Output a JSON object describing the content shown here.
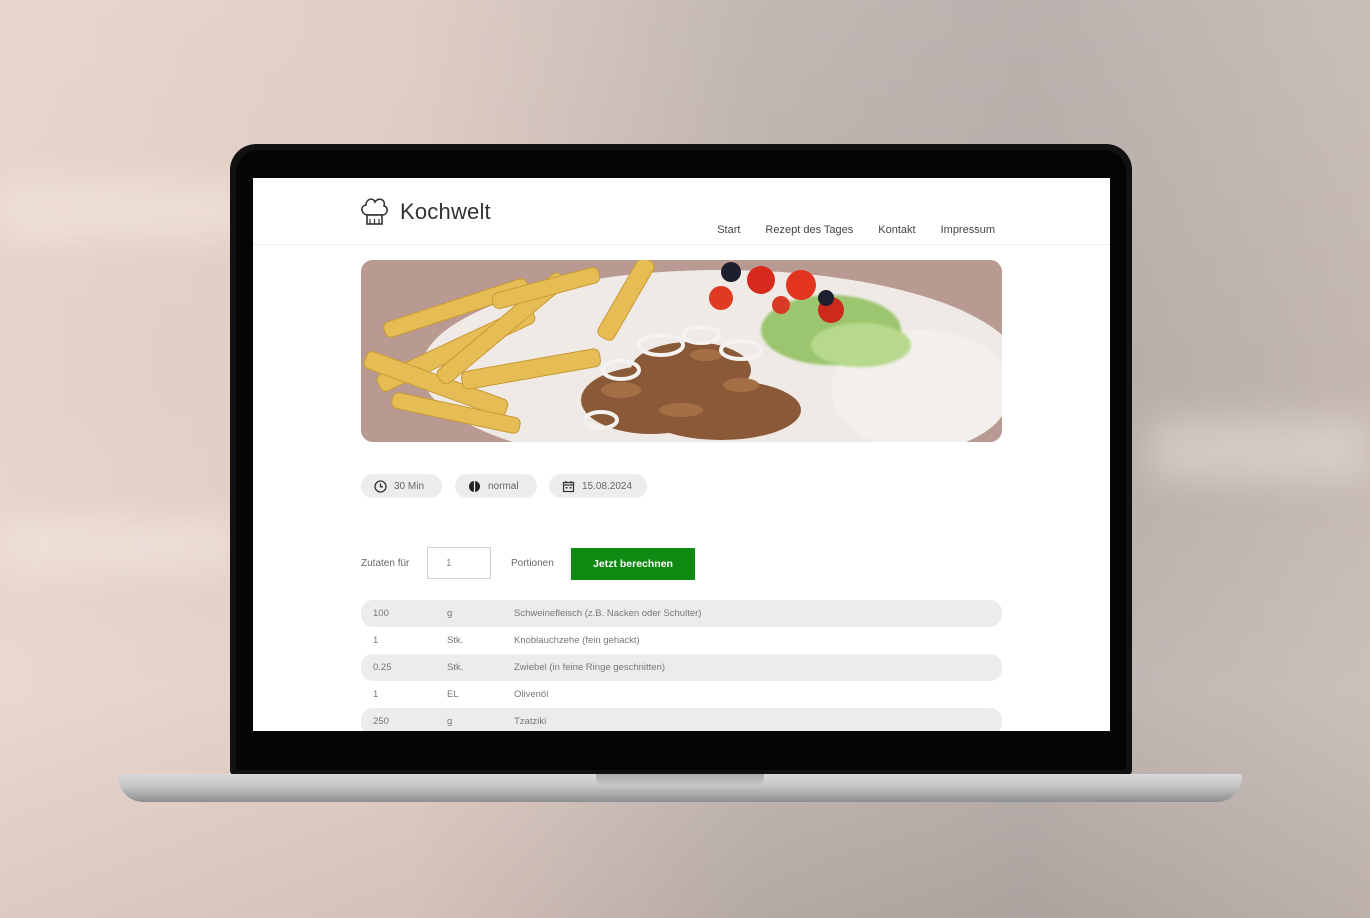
{
  "brand": "Kochwelt",
  "nav": [
    "Start",
    "Rezept des Tages",
    "Kontakt",
    "Impressum"
  ],
  "meta": {
    "time": "30 Min",
    "difficulty": "normal",
    "date": "15.08.2024"
  },
  "portions": {
    "label_before": "Zutaten für",
    "value": "1",
    "label_after": "Portionen",
    "button": "Jetzt berechnen"
  },
  "ingredients": [
    {
      "qty": "100",
      "unit": "g",
      "name": "Schweinefleisch (z.B. Nacken oder Schulter)"
    },
    {
      "qty": "1",
      "unit": "Stk.",
      "name": "Knoblauchzehe (fein gehackt)"
    },
    {
      "qty": "0.25",
      "unit": "Stk.",
      "name": "Zwiebel (in feine Ringe geschnitten)"
    },
    {
      "qty": "1",
      "unit": "EL",
      "name": "Olivenöl"
    },
    {
      "qty": "250",
      "unit": "g",
      "name": "Tzatziki"
    }
  ],
  "colors": {
    "button_green": "#0e8a13",
    "pill_bg": "#ececec",
    "row_shade": "#ececec"
  },
  "icons": [
    "chef-hat-icon",
    "clock-icon",
    "difficulty-icon",
    "calendar-icon"
  ]
}
